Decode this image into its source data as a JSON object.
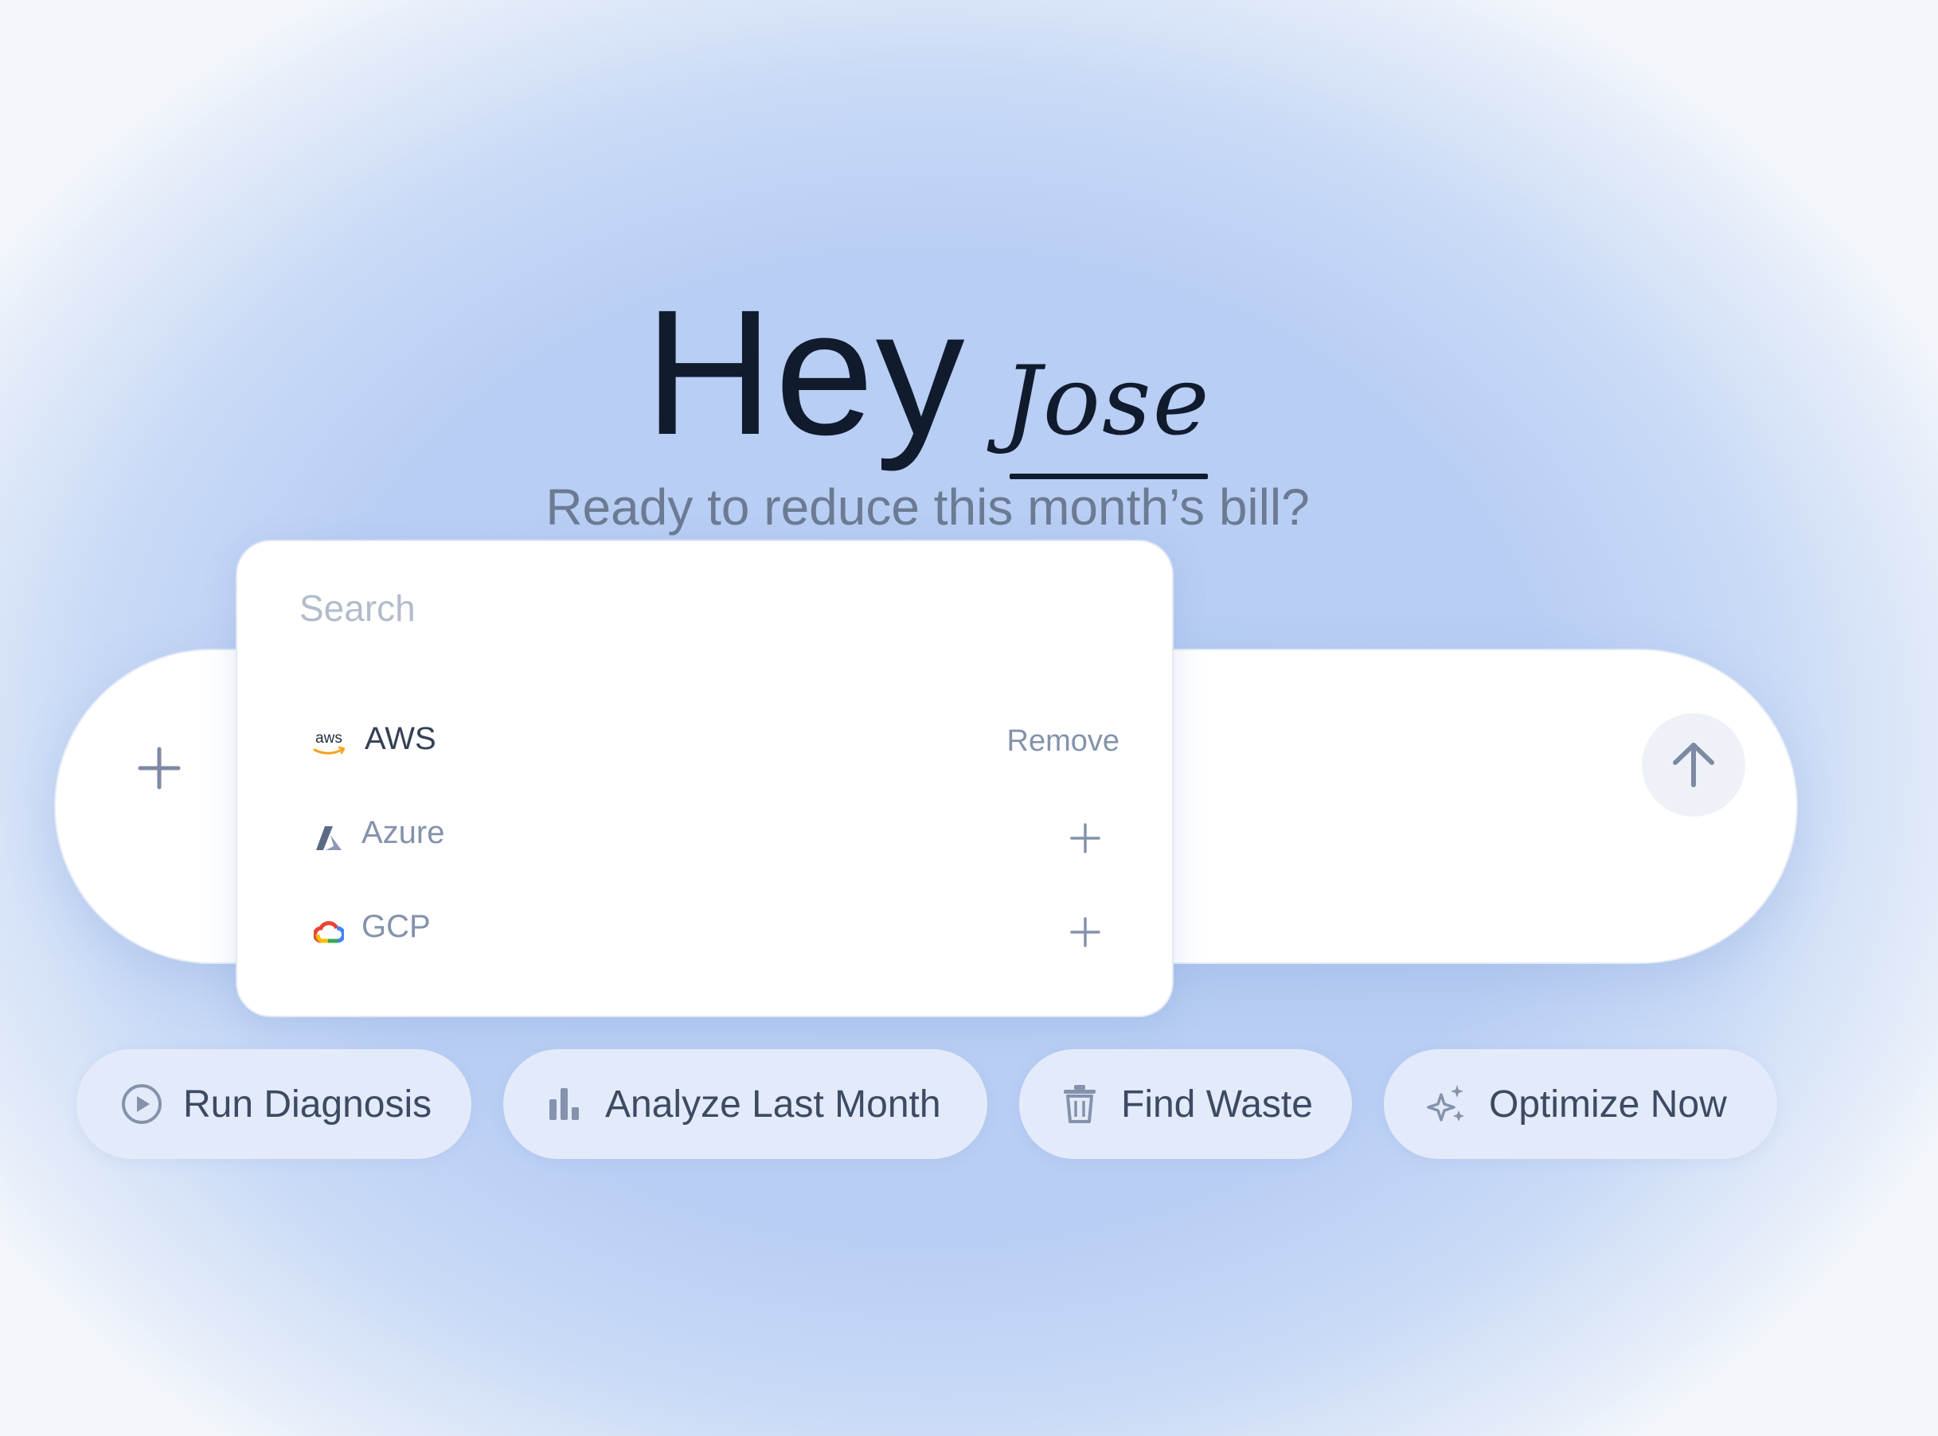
{
  "greeting": {
    "prefix": "Hey",
    "name": "Jose",
    "subtitle": "Ready to reduce this month’s bill?"
  },
  "prompt_bar": {
    "add_icon": "plus-icon",
    "send_icon": "arrow-up-icon"
  },
  "dropdown": {
    "search_placeholder": "Search",
    "search_value": "",
    "providers": [
      {
        "label": "AWS",
        "icon": "aws-logo",
        "connected": true,
        "action_label": "Remove"
      },
      {
        "label": "Azure",
        "icon": "azure-logo",
        "connected": false,
        "action_icon": "plus-icon"
      },
      {
        "label": "GCP",
        "icon": "gcp-logo",
        "connected": false,
        "action_icon": "plus-icon"
      }
    ]
  },
  "quick_actions": [
    {
      "label": "Run Diagnosis",
      "icon": "play-circle-icon"
    },
    {
      "label": "Analyze Last Month",
      "icon": "bar-chart-icon"
    },
    {
      "label": "Find Waste",
      "icon": "trash-icon"
    },
    {
      "label": "Optimize Now",
      "icon": "sparkles-icon"
    }
  ],
  "colors": {
    "background": "#b9cef4",
    "heading": "#111b2e",
    "muted": "#6c7a93",
    "chip_bg": "#e3ebfa",
    "icon": "#8493ab"
  }
}
